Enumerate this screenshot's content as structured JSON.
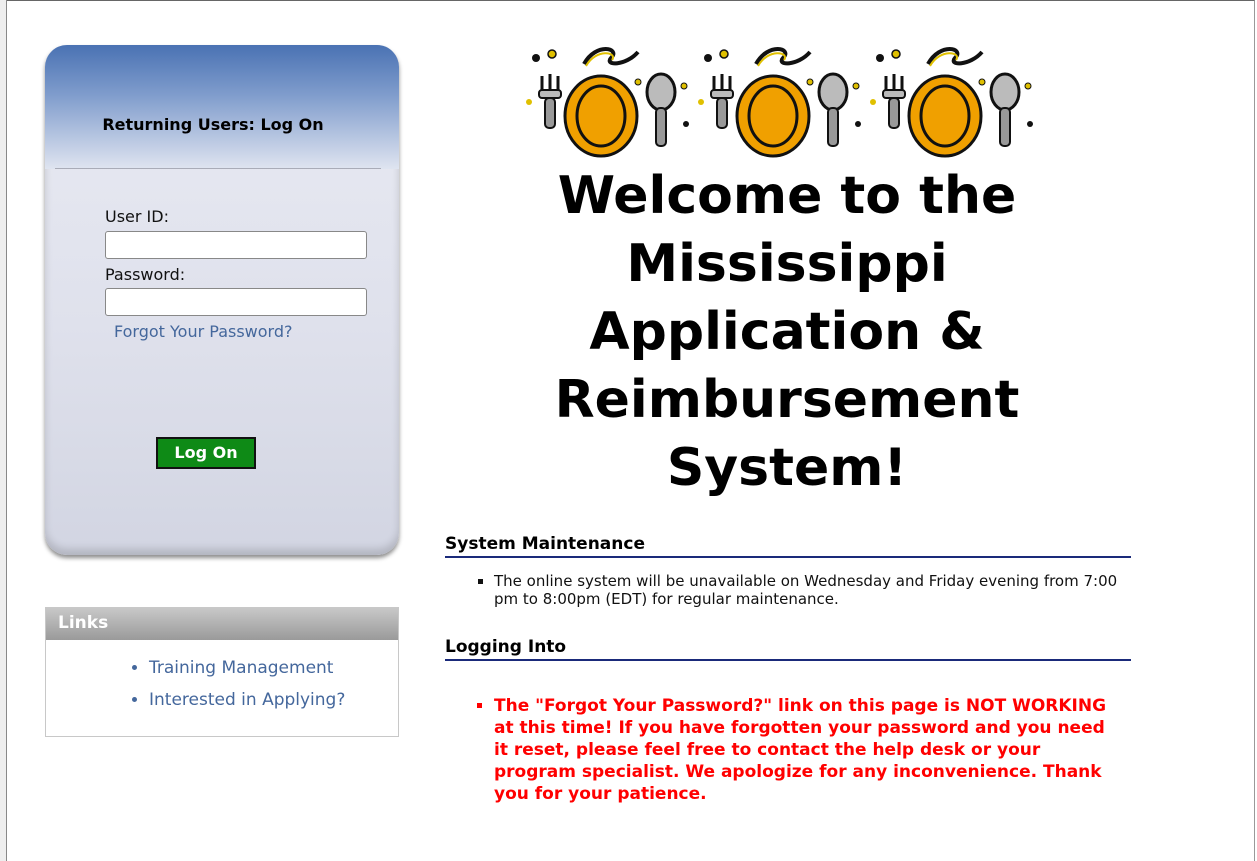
{
  "login": {
    "title": "Returning Users: Log On",
    "user_id_label": "User ID:",
    "user_id_value": "",
    "password_label": "Password:",
    "password_value": "",
    "forgot_link": "Forgot Your Password?",
    "logon_button": "Log On"
  },
  "links": {
    "header": "Links",
    "items": [
      {
        "label": "Training Management"
      },
      {
        "label": "Interested in Applying?"
      }
    ]
  },
  "main": {
    "welcome_lines": [
      "Welcome to the",
      "Mississippi",
      "Application &",
      "Reimbursement",
      "System!"
    ],
    "sections": [
      {
        "title": "System Maintenance",
        "items": [
          "The online system will be unavailable on Wednesday and Friday evening from 7:00 pm to 8:00pm (EDT) for regular maintenance."
        ]
      },
      {
        "title": "Logging Into",
        "items": [
          "The \"Forgot Your Password?\" link on this page is NOT WORKING at this time!  If you have forgotten your password and you need it reset, please feel free to contact the help desk or your program specialist.  We apologize for any inconvenience.  Thank you for your patience."
        ]
      }
    ]
  },
  "colors": {
    "logon_button": "#0e8a16",
    "link": "#44679c",
    "alert": "#ff0000",
    "section_rule": "#1a2a7a"
  }
}
